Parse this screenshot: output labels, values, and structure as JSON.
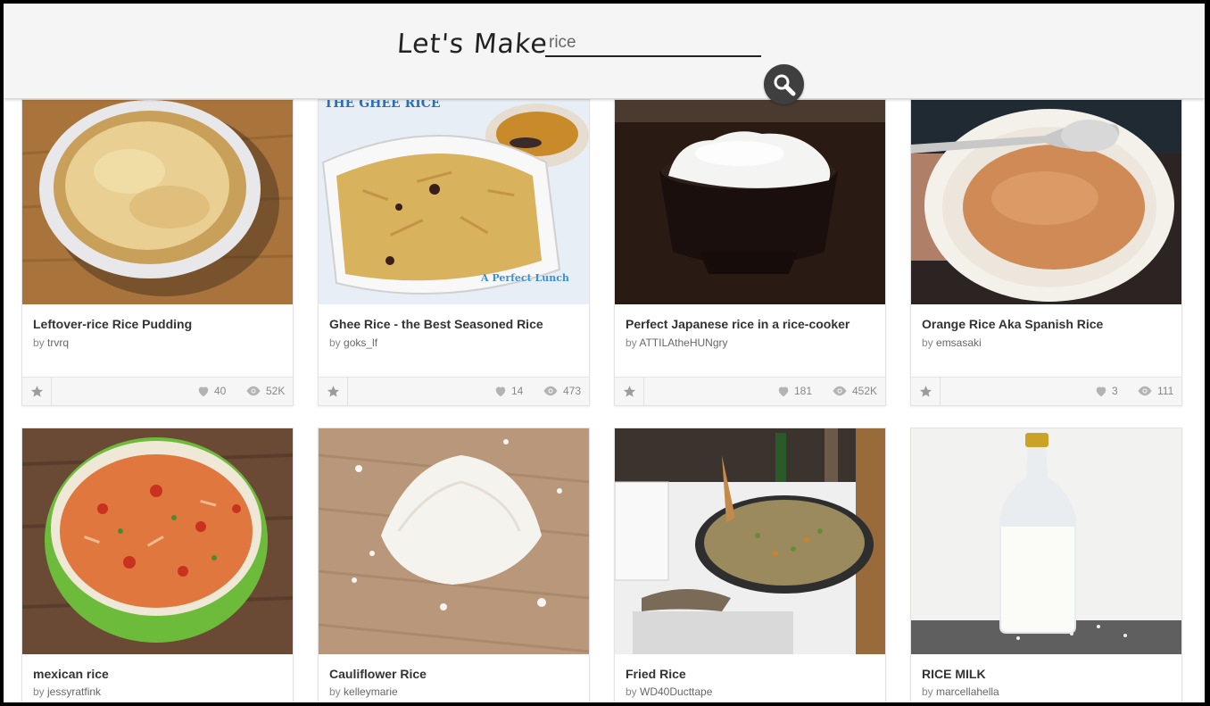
{
  "header": {
    "brand": "Let's Make",
    "search": {
      "value": "rice",
      "placeholder": ""
    }
  },
  "icons": {
    "search": "search-icon",
    "favorite": "star-icon",
    "likes": "heart-icon",
    "views": "eye-icon"
  },
  "colors": {
    "header_bg": "#f5f5f5",
    "button": "#3f3f3f",
    "icon_gray": "#b3b3b3"
  },
  "cards": [
    {
      "title": "Leftover-rice Rice Pudding",
      "by_prefix": "by ",
      "author": "trvrq",
      "likes": "40",
      "views": "52K"
    },
    {
      "title": "Ghee Rice - the Best Seasoned Rice",
      "by_prefix": "by ",
      "author": "goks_lf",
      "likes": "14",
      "views": "473",
      "image_text_top": "THE GHEE RICE",
      "image_text_bottom": "A Perfect Lunch"
    },
    {
      "title": "Perfect Japanese rice in a rice-cooker",
      "by_prefix": "by ",
      "author": "ATTILAtheHUNgry",
      "likes": "181",
      "views": "452K"
    },
    {
      "title": "Orange Rice Aka Spanish Rice",
      "by_prefix": "by ",
      "author": "emsasaki",
      "likes": "3",
      "views": "111"
    },
    {
      "title": "mexican rice",
      "by_prefix": "by ",
      "author": "jessyratfink"
    },
    {
      "title": "Cauliflower Rice",
      "by_prefix": "by ",
      "author": "kelleymarie"
    },
    {
      "title": "Fried Rice",
      "by_prefix": "by ",
      "author": "WD40Ducttape"
    },
    {
      "title": "RICE MILK",
      "by_prefix": "by ",
      "author": "marcellahella"
    }
  ]
}
